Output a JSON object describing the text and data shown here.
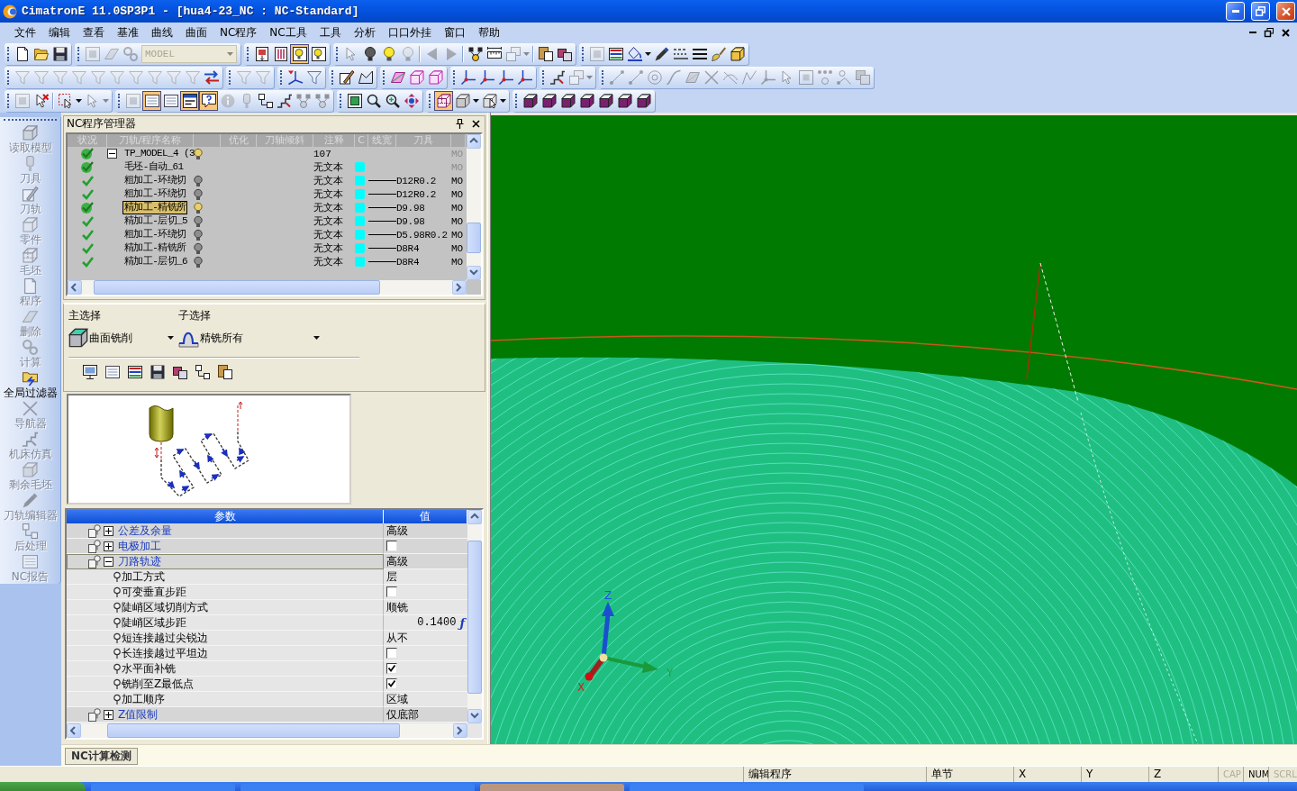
{
  "window": {
    "title": "CimatronE 11.0SP3P1 - [hua4-23_NC : NC-Standard]"
  },
  "menu": [
    "文件",
    "编辑",
    "查看",
    "基准",
    "曲线",
    "曲面",
    "NC程序",
    "NC工具",
    "工具",
    "分析",
    "口口外挂",
    "窗口",
    "帮助"
  ],
  "toolbars": [
    {
      "groups": [
        {
          "items": [
            {
              "kind": "page",
              "pressed": false,
              "disabled": false
            },
            {
              "kind": "folder",
              "pressed": false,
              "disabled": false
            },
            {
              "kind": "floppy",
              "pressed": false,
              "disabled": false
            }
          ]
        },
        {
          "items": [
            {
              "kind": "frame",
              "pressed": false,
              "disabled": true
            },
            {
              "kind": "eraser",
              "pressed": false,
              "disabled": true
            },
            {
              "kind": "gears",
              "pressed": false,
              "disabled": true
            },
            {
              "kind": "combo",
              "value": "MODEL",
              "disabled": true
            }
          ]
        },
        {
          "items": [
            {
              "kind": "panel",
              "pressed": false,
              "disabled": false
            },
            {
              "kind": "columns",
              "pressed": false,
              "disabled": false
            },
            {
              "kind": "bulb-panel",
              "pressed": true,
              "disabled": false
            },
            {
              "kind": "bulb-panel",
              "pressed": false,
              "disabled": false
            }
          ]
        },
        {
          "items": [
            {
              "kind": "pointer",
              "pressed": false,
              "disabled": true
            },
            {
              "kind": "lamp",
              "pressed": false,
              "disabled": false
            },
            {
              "kind": "bulb",
              "pressed": false,
              "disabled": false
            },
            {
              "kind": "bulb",
              "pressed": false,
              "disabled": true
            },
            {
              "kind": "separator"
            },
            {
              "kind": "arrow-left",
              "pressed": false,
              "disabled": true
            },
            {
              "kind": "arrow-right",
              "pressed": false,
              "disabled": true
            },
            {
              "kind": "separator"
            },
            {
              "kind": "tree",
              "pressed": false,
              "disabled": false
            },
            {
              "kind": "ruler",
              "pressed": false,
              "disabled": false
            },
            {
              "kind": "layers",
              "pressed": false,
              "disabled": true
            },
            {
              "kind": "caret",
              "pressed": false,
              "disabled": true
            },
            {
              "kind": "separator"
            },
            {
              "kind": "clipboard",
              "pressed": false,
              "disabled": false
            },
            {
              "kind": "boxes",
              "pressed": false,
              "disabled": false
            }
          ]
        },
        {
          "items": [
            {
              "kind": "frame",
              "pressed": false,
              "disabled": true
            },
            {
              "kind": "grid",
              "pressed": false,
              "disabled": false
            },
            {
              "kind": "bucket",
              "pressed": false,
              "disabled": false
            },
            {
              "kind": "caret",
              "pressed": false,
              "disabled": false
            },
            {
              "kind": "pen",
              "pressed": false,
              "disabled": false
            },
            {
              "kind": "dashes",
              "pressed": false,
              "disabled": false
            },
            {
              "kind": "bars",
              "pressed": false,
              "disabled": false
            },
            {
              "kind": "brush",
              "pressed": false,
              "disabled": false
            },
            {
              "kind": "cube",
              "pressed": false,
              "disabled": false
            }
          ]
        }
      ]
    },
    {
      "groups": [
        {
          "items": [
            {
              "kind": "funnel",
              "pressed": false,
              "disabled": true
            },
            {
              "kind": "funnel",
              "pressed": false,
              "disabled": true
            },
            {
              "kind": "funnel",
              "pressed": false,
              "disabled": true
            },
            {
              "kind": "funnel",
              "pressed": false,
              "disabled": true
            },
            {
              "kind": "funnel",
              "pressed": false,
              "disabled": true
            },
            {
              "kind": "funnel",
              "pressed": false,
              "disabled": true
            },
            {
              "kind": "funnel",
              "pressed": false,
              "disabled": true
            },
            {
              "kind": "funnel",
              "pressed": false,
              "disabled": true
            },
            {
              "kind": "funnel",
              "pressed": false,
              "disabled": true
            },
            {
              "kind": "funnel",
              "pressed": false,
              "disabled": true
            },
            {
              "kind": "swap",
              "pressed": false,
              "disabled": false
            }
          ]
        },
        {
          "items": [
            {
              "kind": "funnel",
              "pressed": false,
              "disabled": true
            },
            {
              "kind": "funnel",
              "pressed": false,
              "disabled": true
            }
          ]
        },
        {
          "items": [
            {
              "kind": "axes-funnel",
              "pressed": false,
              "disabled": false
            },
            {
              "kind": "funnel",
              "pressed": false,
              "disabled": false
            }
          ]
        },
        {
          "items": [
            {
              "kind": "pencil",
              "pressed": false,
              "disabled": false
            },
            {
              "kind": "polygon",
              "pressed": false,
              "disabled": false
            }
          ]
        },
        {
          "items": [
            {
              "kind": "plane",
              "pressed": false,
              "disabled": false
            },
            {
              "kind": "box",
              "pressed": false,
              "disabled": false
            },
            {
              "kind": "box",
              "pressed": false,
              "disabled": false
            }
          ]
        },
        {
          "items": [
            {
              "kind": "axes",
              "pressed": false,
              "disabled": false
            },
            {
              "kind": "axes",
              "pressed": false,
              "disabled": false
            },
            {
              "kind": "axes",
              "pressed": false,
              "disabled": false
            },
            {
              "kind": "axes",
              "pressed": false,
              "disabled": false
            }
          ]
        },
        {
          "items": [
            {
              "kind": "steps",
              "pressed": false,
              "disabled": false
            },
            {
              "kind": "layers",
              "pressed": false,
              "disabled": true
            },
            {
              "kind": "caret",
              "pressed": false,
              "disabled": true
            }
          ]
        },
        {
          "items": [
            {
              "kind": "line",
              "pressed": false,
              "disabled": true
            },
            {
              "kind": "line",
              "pressed": false,
              "disabled": true
            },
            {
              "kind": "circle",
              "pressed": false,
              "disabled": true
            },
            {
              "kind": "curve",
              "pressed": false,
              "disabled": true
            },
            {
              "kind": "plane",
              "pressed": false,
              "disabled": true
            },
            {
              "kind": "cross-lines",
              "pressed": false,
              "disabled": true
            },
            {
              "kind": "crossed-curve",
              "pressed": false,
              "disabled": true
            },
            {
              "kind": "polyline",
              "pressed": false,
              "disabled": true
            },
            {
              "kind": "axes",
              "pressed": false,
              "disabled": true
            },
            {
              "kind": "pointer",
              "pressed": false,
              "disabled": true
            },
            {
              "kind": "square",
              "pressed": false,
              "disabled": true
            },
            {
              "kind": "dots",
              "pressed": false,
              "disabled": true
            },
            {
              "kind": "point",
              "pressed": false,
              "disabled": true
            },
            {
              "kind": "shapes",
              "pressed": false,
              "disabled": true
            }
          ]
        }
      ]
    },
    {
      "groups": [
        {
          "items": [
            {
              "kind": "frame",
              "pressed": false,
              "disabled": true
            },
            {
              "kind": "pointer-x",
              "pressed": false,
              "disabled": false
            },
            {
              "kind": "separator"
            },
            {
              "kind": "selection-rect",
              "pressed": false,
              "disabled": false
            },
            {
              "kind": "caret",
              "pressed": false,
              "disabled": false
            },
            {
              "kind": "pointer",
              "pressed": false,
              "disabled": true
            },
            {
              "kind": "caret",
              "pressed": false,
              "disabled": true
            }
          ]
        },
        {
          "items": [
            {
              "kind": "frame",
              "pressed": false,
              "disabled": true
            },
            {
              "kind": "list",
              "pressed": true,
              "disabled": false
            },
            {
              "kind": "list",
              "pressed": false,
              "disabled": false
            },
            {
              "kind": "window",
              "pressed": true,
              "disabled": false
            },
            {
              "kind": "bubble",
              "pressed": true,
              "disabled": false
            },
            {
              "kind": "info",
              "pressed": false,
              "disabled": true
            },
            {
              "kind": "cutter",
              "pressed": false,
              "disabled": true
            },
            {
              "kind": "nodes",
              "pressed": false,
              "disabled": false
            },
            {
              "kind": "steps",
              "pressed": false,
              "disabled": false
            },
            {
              "kind": "tree",
              "pressed": false,
              "disabled": true
            },
            {
              "kind": "tree",
              "pressed": false,
              "disabled": true
            }
          ]
        },
        {
          "items": [
            {
              "kind": "zoom-window",
              "pressed": false,
              "disabled": false
            },
            {
              "kind": "zoom",
              "pressed": false,
              "disabled": false
            },
            {
              "kind": "zoom-in",
              "pressed": false,
              "disabled": false
            },
            {
              "kind": "move-arrows",
              "pressed": false,
              "disabled": false
            }
          ]
        },
        {
          "items": [
            {
              "kind": "wire-cube",
              "pressed": true,
              "disabled": false
            },
            {
              "kind": "shaded-cube",
              "pressed": false,
              "disabled": false
            },
            {
              "kind": "caret",
              "pressed": false,
              "disabled": false
            },
            {
              "kind": "cube-pointer",
              "pressed": false,
              "disabled": false
            },
            {
              "kind": "caret",
              "pressed": false,
              "disabled": false
            }
          ]
        },
        {
          "items": [
            {
              "kind": "solid-cube",
              "pressed": false,
              "disabled": false
            },
            {
              "kind": "solid-cube",
              "pressed": false,
              "disabled": false
            },
            {
              "kind": "solid-cube",
              "pressed": false,
              "disabled": false
            },
            {
              "kind": "solid-cube",
              "pressed": false,
              "disabled": false
            },
            {
              "kind": "solid-cube",
              "pressed": false,
              "disabled": false
            },
            {
              "kind": "solid-cube",
              "pressed": false,
              "disabled": false
            },
            {
              "kind": "solid-cube",
              "pressed": false,
              "disabled": false
            }
          ]
        }
      ]
    }
  ],
  "sidebar": {
    "items": [
      {
        "label": "读取模型",
        "kind": "cube",
        "disabled": true
      },
      {
        "label": "刀具",
        "kind": "cutter",
        "disabled": true
      },
      {
        "label": "刀轨",
        "kind": "pencil",
        "disabled": true
      },
      {
        "label": "零件",
        "kind": "box",
        "disabled": true
      },
      {
        "label": "毛坯",
        "kind": "wire-cube",
        "disabled": true
      },
      {
        "label": "程序",
        "kind": "page",
        "disabled": true
      },
      {
        "label": "删除",
        "kind": "eraser",
        "disabled": true
      },
      {
        "label": "计算",
        "kind": "gears",
        "disabled": true
      },
      {
        "label": "全局过滤器",
        "kind": "folder-bolt",
        "disabled": false
      },
      {
        "label": "导航器",
        "kind": "cross-lines",
        "disabled": true
      },
      {
        "label": "机床仿真",
        "kind": "steps",
        "disabled": true
      },
      {
        "label": "剩余毛坯",
        "kind": "shaded-cube",
        "disabled": true
      },
      {
        "label": "刀轨编辑器",
        "kind": "pen",
        "disabled": true
      },
      {
        "label": "后处理",
        "kind": "nodes",
        "disabled": true
      },
      {
        "label": "NC报告",
        "kind": "list",
        "disabled": true
      }
    ]
  },
  "nc_manager": {
    "title": "NC程序管理器",
    "columns": [
      "状况",
      "刀轨/程序名称",
      "优化",
      "刀轴倾斜",
      "注释",
      "C",
      "线宽",
      "刀具"
    ],
    "rows": [
      {
        "name": "TP_MODEL_4 (3",
        "selected": false,
        "expanded": true,
        "disc": true,
        "lit": true,
        "comment": "107",
        "column_10": "MO",
        "dim": true,
        "children": [
          {
            "name": "毛坯-自动_61",
            "selected": false,
            "disc": true,
            "comment": "无文本",
            "swatch": true,
            "column_10": "MO",
            "dim": true
          },
          {
            "name": "粗加工-环绕切",
            "selected": false,
            "disc": false,
            "lit": false,
            "comment": "无文本",
            "swatch": true,
            "tool": "D12R0.2",
            "column_10": "MO",
            "dim": false
          },
          {
            "name": "粗加工-环绕切",
            "selected": false,
            "disc": false,
            "lit": false,
            "comment": "无文本",
            "swatch": true,
            "tool": "D12R0.2",
            "column_10": "MO",
            "dim": false
          },
          {
            "name": "精加工-精铣所",
            "selected": true,
            "disc": true,
            "lit": true,
            "comment": "无文本",
            "swatch": true,
            "tool": "D9.98",
            "column_10": "MO",
            "dim": false
          },
          {
            "name": "精加工-层切_5",
            "selected": false,
            "disc": false,
            "lit": false,
            "comment": "无文本",
            "swatch": true,
            "tool": "D9.98",
            "column_10": "MO",
            "dim": false
          },
          {
            "name": "粗加工-环绕切",
            "selected": false,
            "disc": false,
            "lit": false,
            "comment": "无文本",
            "swatch": true,
            "tool": "D5.98R0.2",
            "column_10": "MO",
            "dim": false
          },
          {
            "name": "精加工-精铣所",
            "selected": false,
            "disc": false,
            "lit": false,
            "comment": "无文本",
            "swatch": true,
            "tool": "D8R4",
            "column_10": "MO",
            "dim": false
          },
          {
            "name": "精加工-层切_6",
            "selected": false,
            "disc": false,
            "lit": false,
            "comment": "无文本",
            "swatch": true,
            "tool": "D8R4",
            "column_10": "MO",
            "dim": false
          }
        ]
      }
    ]
  },
  "selection": {
    "main": {
      "label": "主选择",
      "value": "曲面铣削"
    },
    "sub": {
      "label": "子选择",
      "value": "精铣所有"
    }
  },
  "parameters": {
    "columns": [
      "参数",
      "值"
    ],
    "rows": [
      {
        "label": "公差及余量",
        "kind": "text",
        "value": "高级",
        "expanded": false,
        "selected": false
      },
      {
        "label": "电极加工",
        "kind": "checkbox",
        "checked": false,
        "expanded": false,
        "selected": false
      },
      {
        "label": "刀路轨迹",
        "kind": "text",
        "value": "高级",
        "expanded": true,
        "selected": true,
        "children": [
          {
            "label": "加工方式",
            "kind": "text",
            "value": "层",
            "selected": false
          },
          {
            "label": "可变垂直步距",
            "kind": "checkbox",
            "checked": false,
            "selected": false
          },
          {
            "label": "陡峭区域切削方式",
            "kind": "text",
            "value": "顺铣",
            "selected": false
          },
          {
            "label": "陡峭区域步距",
            "kind": "number",
            "value": "0.1400",
            "formula": "ƒ",
            "selected": false
          },
          {
            "label": "短连接越过尖锐边",
            "kind": "text",
            "value": "从不",
            "selected": false
          },
          {
            "label": "长连接越过平坦边",
            "kind": "checkbox",
            "checked": false,
            "selected": false
          },
          {
            "label": "水平面补铣",
            "kind": "checkbox",
            "checked": true,
            "selected": false
          },
          {
            "label": "铣削至Z最低点",
            "kind": "checkbox",
            "checked": true,
            "selected": false
          },
          {
            "label": "加工顺序",
            "kind": "text",
            "value": "区域",
            "selected": false
          }
        ]
      },
      {
        "label": "Z值限制",
        "kind": "text",
        "value": "仅底部",
        "expanded": false,
        "selected": false
      }
    ]
  },
  "bottom_tabs": [
    {
      "label": "NC计算检测",
      "selected": true
    }
  ],
  "viewport": {
    "axes": {
      "x": "X",
      "y": "Y",
      "z": "Z"
    }
  },
  "status_bar": [
    {
      "text": "编辑程序",
      "disabled": false
    },
    {
      "text": "单节",
      "disabled": false
    },
    {
      "text": "X",
      "disabled": false
    },
    {
      "text": "Y",
      "disabled": false
    },
    {
      "text": "Z",
      "disabled": false
    },
    {
      "text": "CAP",
      "disabled": true
    },
    {
      "text": "NUM",
      "disabled": false
    },
    {
      "text": "SCRL",
      "disabled": true
    }
  ]
}
